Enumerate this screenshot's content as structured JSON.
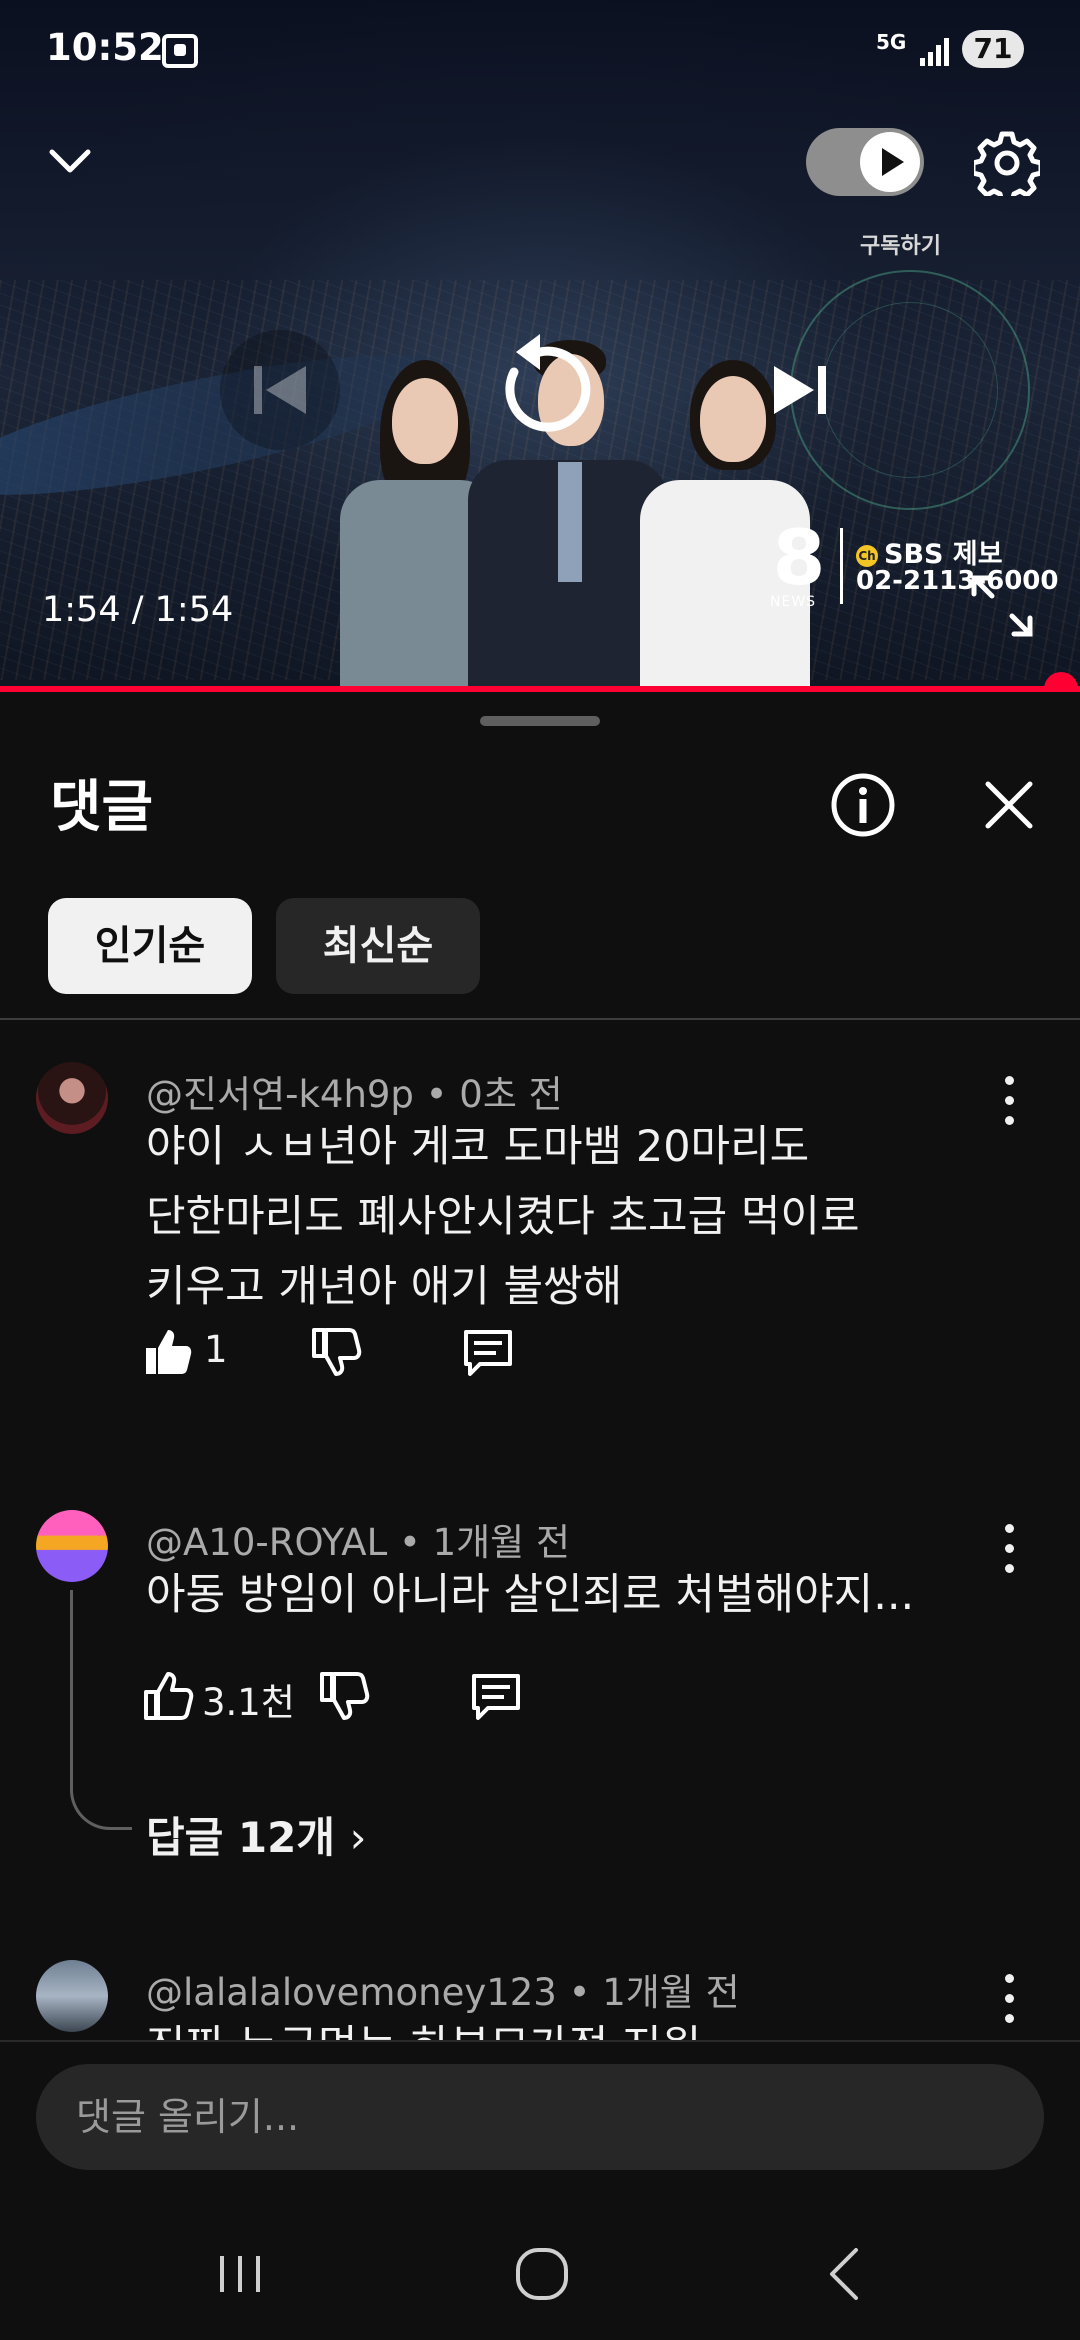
{
  "status_bar": {
    "time": "10:52",
    "network": "5G",
    "battery": "71"
  },
  "player": {
    "autoplay_label": "구독하기",
    "time": "1:54 / 1:54",
    "progress_fraction": 1.0,
    "channel_logo_text": "8",
    "channel_logo_sub": "NEWS",
    "tip_label": "SBS 제보",
    "tip_badge": "Ch",
    "tip_phone": "02-2113-6000"
  },
  "comments_panel": {
    "title": "댓글",
    "sort_chips": [
      {
        "label": "인기순",
        "active": true
      },
      {
        "label": "최신순",
        "active": false
      }
    ],
    "comments": [
      {
        "author": "@진서연-k4h9p",
        "age": "0초 전",
        "text_lines": [
          "야이 ㅅㅂ년아 게코 도마뱀 20마리도",
          "단한마리도 폐사안시켰다  초고급 먹이로",
          "키우고 개년아 애기 불쌍해"
        ],
        "likes": "1"
      },
      {
        "author": "@A10-ROYAL",
        "age": "1개월 전",
        "text_lines": [
          "아동 방임이 아니라 살인죄로 처벌해야지..."
        ],
        "likes": "3.1천",
        "replies": "답글 12개"
      },
      {
        "author": "@lalalalovemoney123",
        "age": "1개월 전",
        "text_lines": [
          "진짜 누구먹는 하부모가정 지원"
        ]
      }
    ],
    "input_placeholder": "댓글 올리기..."
  },
  "colors": {
    "accent": "#ff0033",
    "background": "#0f0f0f",
    "chip_active_bg": "#f1f1f1",
    "chip_inactive_bg": "#272727",
    "meta_text": "#aaaaaa"
  },
  "icons": {
    "collapse": "chevron-down-icon",
    "settings": "gear-icon",
    "info": "info-icon",
    "close": "close-icon",
    "like": "thumbs-up-icon",
    "dislike": "thumbs-down-icon",
    "reply": "comment-icon"
  }
}
